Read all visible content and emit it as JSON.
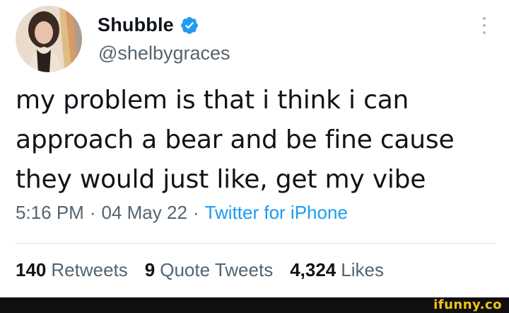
{
  "author": {
    "display_name": "Shubble",
    "handle": "@shelbygraces",
    "verified": true
  },
  "tweet": {
    "text_lines": [
      "my problem is that i think i can",
      "approach a bear and be fine cause",
      "they would just like, get my vibe"
    ]
  },
  "meta": {
    "time": "5:16 PM",
    "separator": "·",
    "date": "04 May 22",
    "source": "Twitter for iPhone"
  },
  "stats": {
    "retweets_count": "140",
    "retweets_label": "Retweets",
    "quotes_count": "9",
    "quotes_label": "Quote Tweets",
    "likes_count": "4,324",
    "likes_label": "Likes"
  },
  "watermark": {
    "text": "ifunny.co"
  },
  "colors": {
    "text_primary": "#0f1419",
    "text_secondary": "#536471",
    "link_blue": "#1d9bf0",
    "verified_blue": "#1d9bf0",
    "watermark_yellow": "#f3c31b"
  },
  "icons": {
    "verified": "verified-badge-icon",
    "more": "more-vertical-icon"
  }
}
